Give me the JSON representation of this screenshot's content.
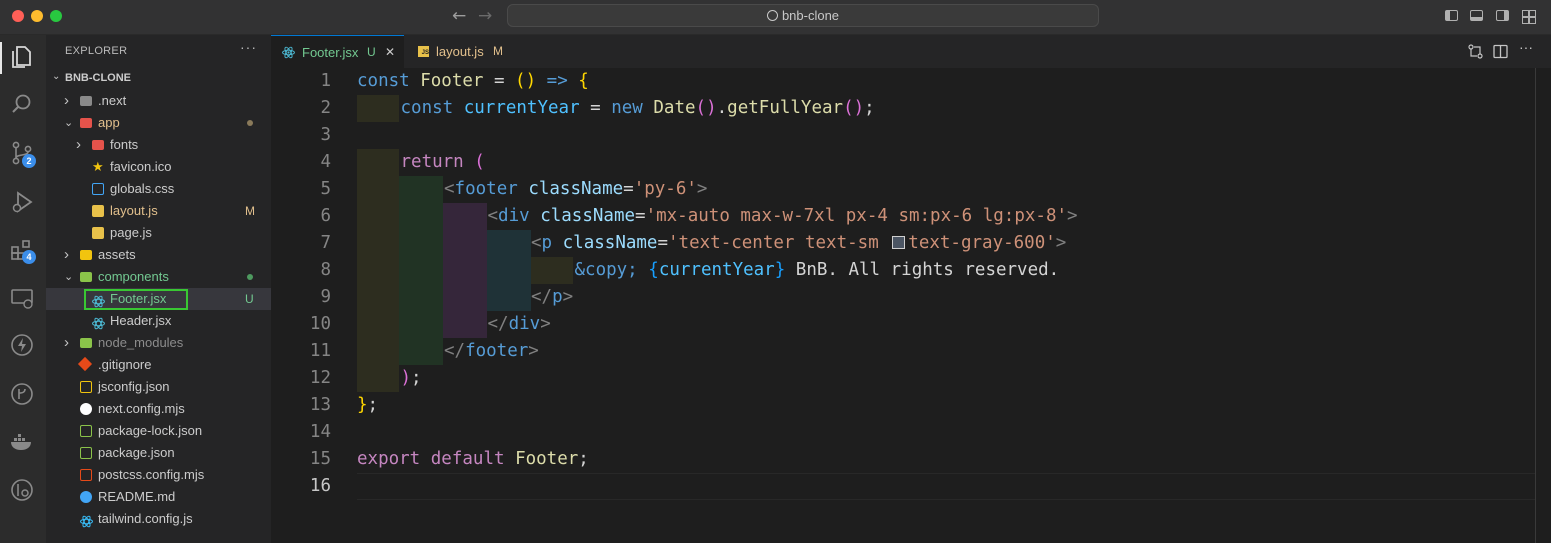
{
  "window": {
    "search_title": "bnb-clone",
    "colors": {
      "close": "#ff5f57",
      "minimize": "#febc2e",
      "maximize": "#28c840"
    }
  },
  "activity_bar": {
    "badges": {
      "source_control": "2",
      "extensions": "4"
    },
    "icons": [
      "explorer-icon",
      "search-icon",
      "source-control-icon",
      "run-debug-icon",
      "extensions-icon",
      "remote-explorer-icon",
      "lightning-icon",
      "git-graph-icon",
      "docker-icon",
      "gitlens-icon"
    ]
  },
  "sidebar": {
    "header": "EXPLORER",
    "more": "···",
    "root": "BNB-CLONE",
    "items": [
      {
        "label": ".next",
        "type": "folder",
        "status": ""
      },
      {
        "label": "app",
        "type": "folder",
        "status": "dot"
      },
      {
        "label": "fonts",
        "type": "folder",
        "status": ""
      },
      {
        "label": "favicon.ico",
        "type": "file",
        "status": ""
      },
      {
        "label": "globals.css",
        "type": "file",
        "status": ""
      },
      {
        "label": "layout.js",
        "type": "file",
        "status": "M"
      },
      {
        "label": "page.js",
        "type": "file",
        "status": ""
      },
      {
        "label": "assets",
        "type": "folder",
        "status": ""
      },
      {
        "label": "components",
        "type": "folder",
        "status": "dot"
      },
      {
        "label": "Footer.jsx",
        "type": "file",
        "status": "U"
      },
      {
        "label": "Header.jsx",
        "type": "file",
        "status": ""
      },
      {
        "label": "node_modules",
        "type": "folder",
        "status": ""
      },
      {
        "label": ".gitignore",
        "type": "file",
        "status": ""
      },
      {
        "label": "jsconfig.json",
        "type": "file",
        "status": ""
      },
      {
        "label": "next.config.mjs",
        "type": "file",
        "status": ""
      },
      {
        "label": "package-lock.json",
        "type": "file",
        "status": ""
      },
      {
        "label": "package.json",
        "type": "file",
        "status": ""
      },
      {
        "label": "postcss.config.mjs",
        "type": "file",
        "status": ""
      },
      {
        "label": "README.md",
        "type": "file",
        "status": ""
      },
      {
        "label": "tailwind.config.js",
        "type": "file",
        "status": ""
      }
    ]
  },
  "tabs": [
    {
      "label": "Footer.jsx",
      "status": "U",
      "active": true,
      "close": "✕"
    },
    {
      "label": "layout.js",
      "status": "M",
      "active": false
    }
  ],
  "editor": {
    "line_numbers": [
      "1",
      "2",
      "3",
      "4",
      "5",
      "6",
      "7",
      "8",
      "9",
      "10",
      "11",
      "12",
      "13",
      "14",
      "15",
      "16"
    ],
    "active_line": "16",
    "lines": [
      [
        [
          "kw",
          "const "
        ],
        [
          "fn",
          "Footer"
        ],
        [
          "plain",
          " = "
        ],
        [
          "br1",
          "()"
        ],
        [
          "plain",
          " "
        ],
        [
          "kw",
          "=>"
        ],
        [
          "plain",
          " "
        ],
        [
          "br1",
          "{"
        ]
      ],
      [
        [
          "kw",
          "const "
        ],
        [
          "var",
          "currentYear"
        ],
        [
          "plain",
          " = "
        ],
        [
          "kw",
          "new "
        ],
        [
          "fn",
          "Date"
        ],
        [
          "br2",
          "()"
        ],
        [
          "plain",
          "."
        ],
        [
          "fn",
          "getFullYear"
        ],
        [
          "br2",
          "()"
        ],
        [
          "plain",
          ";"
        ]
      ],
      [],
      [
        [
          "kw2",
          "return "
        ],
        [
          "br2",
          "("
        ]
      ],
      [
        [
          "punct",
          "<"
        ],
        [
          "tag",
          "footer"
        ],
        [
          "plain",
          " "
        ],
        [
          "attr",
          "className"
        ],
        [
          "plain",
          "="
        ],
        [
          "str",
          "'py-6'"
        ],
        [
          "punct",
          ">"
        ]
      ],
      [
        [
          "punct",
          "<"
        ],
        [
          "tag",
          "div"
        ],
        [
          "plain",
          " "
        ],
        [
          "attr",
          "className"
        ],
        [
          "plain",
          "="
        ],
        [
          "str",
          "'mx-auto max-w-7xl px-4 sm:px-6 lg:px-8'"
        ],
        [
          "punct",
          ">"
        ]
      ],
      [
        [
          "punct",
          "<"
        ],
        [
          "tag",
          "p"
        ],
        [
          "plain",
          " "
        ],
        [
          "attr",
          "className"
        ],
        [
          "plain",
          "="
        ],
        [
          "str",
          "'text-center text-sm "
        ],
        [
          "swatch",
          ""
        ],
        [
          "str",
          "text-gray-600'"
        ],
        [
          "punct",
          ">"
        ]
      ],
      [
        [
          "kw",
          "&copy;"
        ],
        [
          "plain",
          " "
        ],
        [
          "br3",
          "{"
        ],
        [
          "var",
          "currentYear"
        ],
        [
          "br3",
          "}"
        ],
        [
          "plain",
          " BnB. All rights reserved."
        ]
      ],
      [
        [
          "punct",
          "</"
        ],
        [
          "tag",
          "p"
        ],
        [
          "punct",
          ">"
        ]
      ],
      [
        [
          "punct",
          "</"
        ],
        [
          "tag",
          "div"
        ],
        [
          "punct",
          ">"
        ]
      ],
      [
        [
          "punct",
          "</"
        ],
        [
          "tag",
          "footer"
        ],
        [
          "punct",
          ">"
        ]
      ],
      [
        [
          "br2",
          ")"
        ],
        [
          "plain",
          ";"
        ]
      ],
      [
        [
          "br1",
          "}"
        ],
        [
          "plain",
          ";"
        ]
      ],
      [],
      [
        [
          "kw2",
          "export "
        ],
        [
          "kw2",
          "default "
        ],
        [
          "fn",
          "Footer"
        ],
        [
          "plain",
          ";"
        ]
      ],
      []
    ],
    "swatch_color": "#4b5563"
  }
}
